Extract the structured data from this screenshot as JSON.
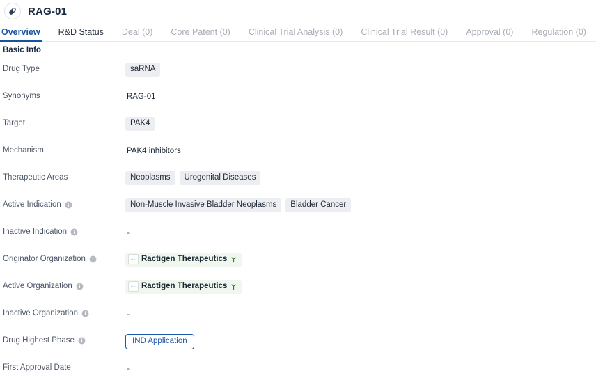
{
  "header": {
    "icon": "capsule-icon",
    "title": "RAG-01"
  },
  "tabs": [
    {
      "label": "Overview",
      "state": "active"
    },
    {
      "label": "R&D Status",
      "state": "enabled"
    },
    {
      "label": "Deal (0)",
      "state": "disabled"
    },
    {
      "label": "Core Patent (0)",
      "state": "disabled"
    },
    {
      "label": "Clinical Trial Analysis (0)",
      "state": "disabled"
    },
    {
      "label": "Clinical Trial Result (0)",
      "state": "disabled"
    },
    {
      "label": "Approval (0)",
      "state": "disabled"
    },
    {
      "label": "Regulation (0)",
      "state": "disabled"
    }
  ],
  "section": {
    "title": "Basic Info"
  },
  "fields": {
    "drug_type": {
      "label": "Drug Type",
      "tags": [
        "saRNA"
      ]
    },
    "synonyms": {
      "label": "Synonyms",
      "text": "RAG-01"
    },
    "target": {
      "label": "Target",
      "tags": [
        "PAK4"
      ]
    },
    "mechanism": {
      "label": "Mechanism",
      "text": "PAK4 inhibitors"
    },
    "therapeutic_areas": {
      "label": "Therapeutic Areas",
      "tags": [
        "Neoplasms",
        "Urogenital Diseases"
      ]
    },
    "active_indication": {
      "label": "Active Indication",
      "has_info": true,
      "tags": [
        "Non-Muscle Invasive Bladder Neoplasms",
        "Bladder Cancer"
      ]
    },
    "inactive_indication": {
      "label": "Inactive Indication",
      "has_info": true,
      "text": "-"
    },
    "originator_organization": {
      "label": "Originator Organization",
      "has_info": true,
      "orgs": [
        {
          "name": "Ractigen Therapeutics",
          "flag": "sprout-icon"
        }
      ]
    },
    "active_organization": {
      "label": "Active Organization",
      "has_info": true,
      "orgs": [
        {
          "name": "Ractigen Therapeutics",
          "flag": "sprout-icon"
        }
      ]
    },
    "inactive_organization": {
      "label": "Inactive Organization",
      "has_info": true,
      "text": "-"
    },
    "drug_highest_phase": {
      "label": "Drug Highest Phase",
      "has_info": true,
      "phase": "IND Application"
    },
    "first_approval_date": {
      "label": "First Approval Date",
      "has_info": false,
      "text": "-"
    }
  },
  "colors": {
    "accent_blue": "#15539e",
    "tag_bg": "#eceef1",
    "org_bg": "#f0f7ee",
    "org_flag_green": "#2e7d32",
    "phase_border": "#1b57a5"
  }
}
